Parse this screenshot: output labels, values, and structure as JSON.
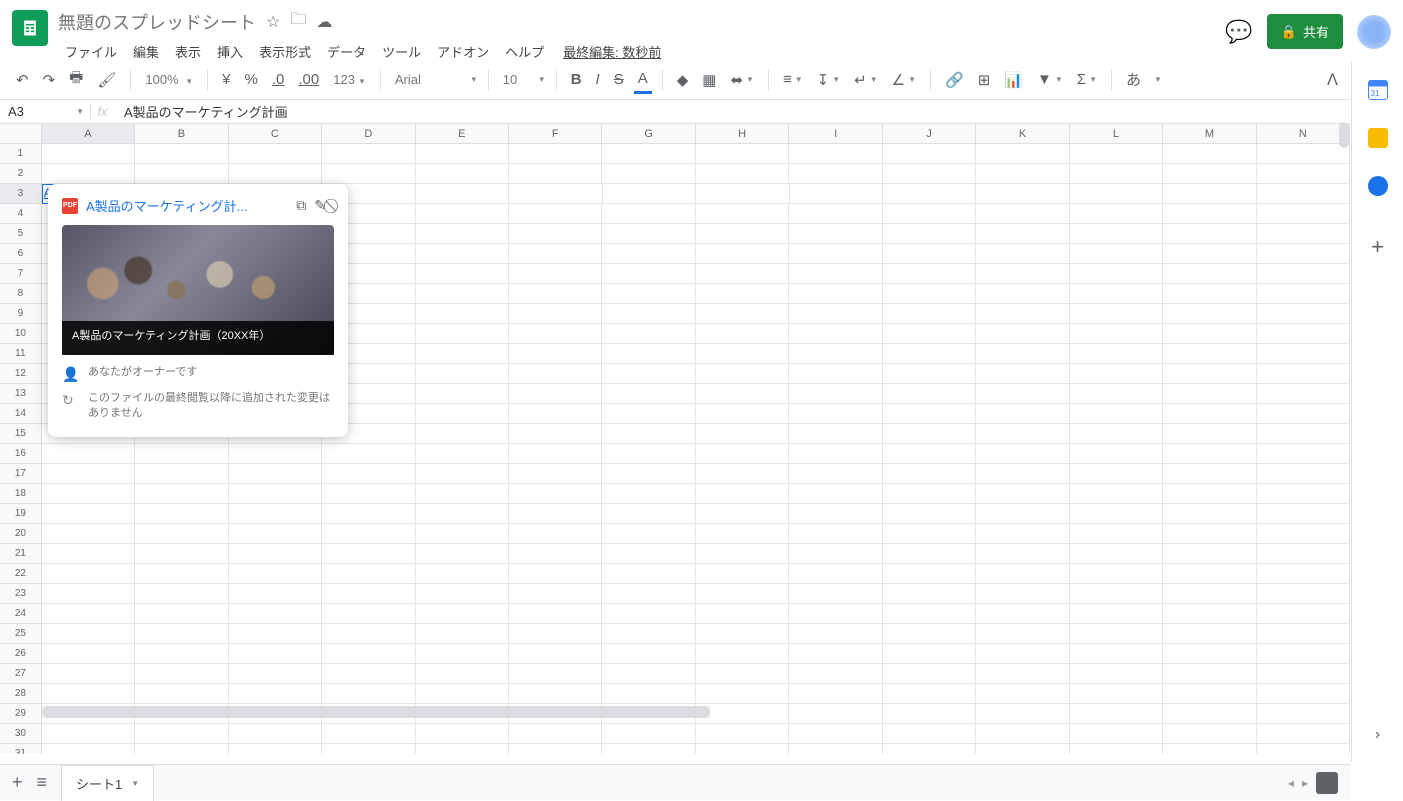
{
  "header": {
    "title": "無題のスプレッドシート",
    "menus": [
      "ファイル",
      "編集",
      "表示",
      "挿入",
      "表示形式",
      "データ",
      "ツール",
      "アドオン",
      "ヘルプ"
    ],
    "last_edit": "最終編集: 数秒前",
    "share_label": "共有"
  },
  "toolbar": {
    "zoom": "100%",
    "currency": "¥",
    "percent": "%",
    "dec_dec": ".0",
    "dec_inc": ".00",
    "num_format": "123",
    "font": "Arial",
    "font_size": "10",
    "ime": "あ"
  },
  "namebox": {
    "ref": "A3"
  },
  "formula": {
    "value": "A製品のマーケティング計画"
  },
  "columns": [
    "A",
    "B",
    "C",
    "D",
    "E",
    "F",
    "G",
    "H",
    "I",
    "J",
    "K",
    "L",
    "M",
    "N"
  ],
  "active_cell": {
    "row": 3,
    "col": "A",
    "text": "A製品のマーケティング計画"
  },
  "hover_card": {
    "title": "A製品のマーケティング計...",
    "img_caption": "A製品のマーケティング計画（20XX年）",
    "owner": "あなたがオーナーです",
    "changes": "このファイルの最終閲覧以降に追加された変更はありません"
  },
  "sheet_tabs": {
    "tab1": "シート1"
  },
  "rows_count": 31
}
